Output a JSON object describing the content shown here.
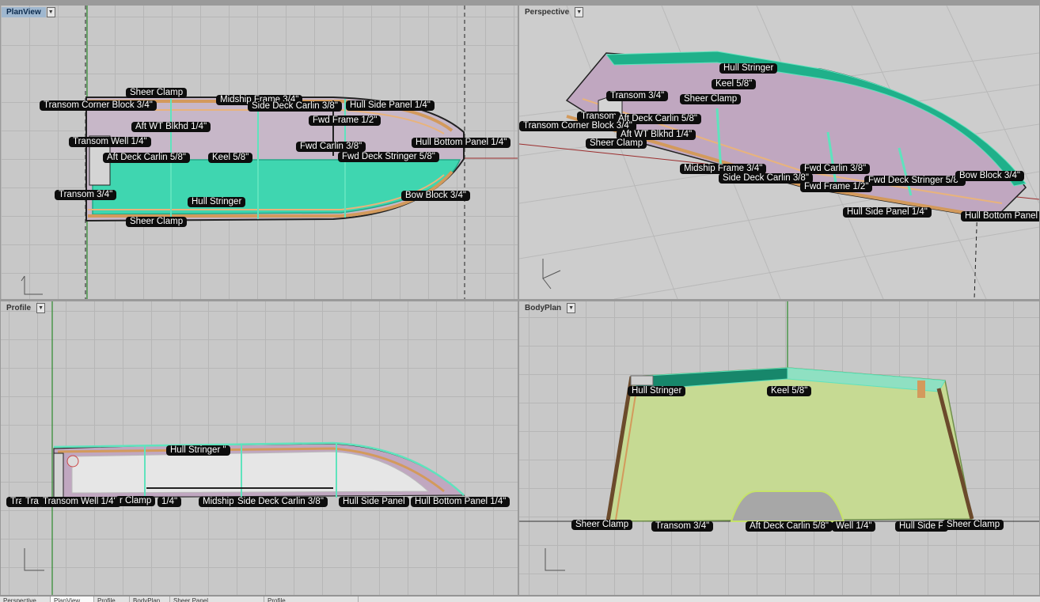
{
  "viewports": {
    "plan": {
      "title": "PlanView",
      "labels": [
        "Sheer Clamp",
        "Transom Corner Block 3/4\"",
        "Midship Frame 3/4\"",
        "Side Deck Carlin 3/8\"",
        "Hull Side Panel 1/4\"",
        "Fwd Frame 1/2\"",
        "Aft WT Blkhd 1/4\"",
        "Transom Well 1/4\"",
        "Fwd Carlin 3/8\"",
        "Hull Bottom Panel 1/4\"",
        "Aft Deck Carlin 5/8\"",
        "Keel 5/8\"",
        "Fwd Deck Stringer 5/8\"",
        "Transom 3/4\"",
        "Bow Block 3/4\"",
        "Hull Stringer",
        "Sheer Clamp"
      ]
    },
    "perspective": {
      "title": "Perspective",
      "labels": [
        "Hull Stringer",
        "Keel 5/8\"",
        "Transom 3/4\"",
        "Sheer Clamp",
        "Transom",
        "Aft Deck Carlin 5/8\"",
        "Transom Corner Block 3/4\"",
        "Aft WT Blkhd 1/4\"",
        "Sheer Clamp",
        "Midship Frame 3/4\"",
        "Fwd Carlin 3/8\"",
        "Side Deck Carlin 3/8\"",
        "Fwd Deck Stringer 5/8\"",
        "Bow Block 3/4\"",
        "Fwd Frame 1/2\"",
        "Hull Side Panel 1/4\"",
        "Hull Bottom Panel"
      ]
    },
    "profile": {
      "title": "Profile",
      "labels": [
        "Hull Stringer \"",
        "Tra",
        "Tra",
        "Transom Well 1/4\"",
        "r Clamp",
        "1/4\"",
        "Midship",
        "Side Deck Carlin 3/8\"",
        "Hull Side Panel",
        "Hull Bottom Panel 1/4\""
      ]
    },
    "bodyplan": {
      "title": "BodyPlan",
      "labels": [
        "Hull Stringer",
        "Keel 5/8\"",
        "Sheer Clamp",
        "Transom 3/4\"",
        "Aft Deck Carlin 5/8\"",
        "Well 1/4\"",
        "Hull Side P",
        "Sheer Clamp"
      ]
    }
  },
  "tabs": [
    "Perspective",
    "PlanView",
    "Profile",
    "BodyPlan",
    "Sheer Panel ...",
    "Profile ..."
  ]
}
